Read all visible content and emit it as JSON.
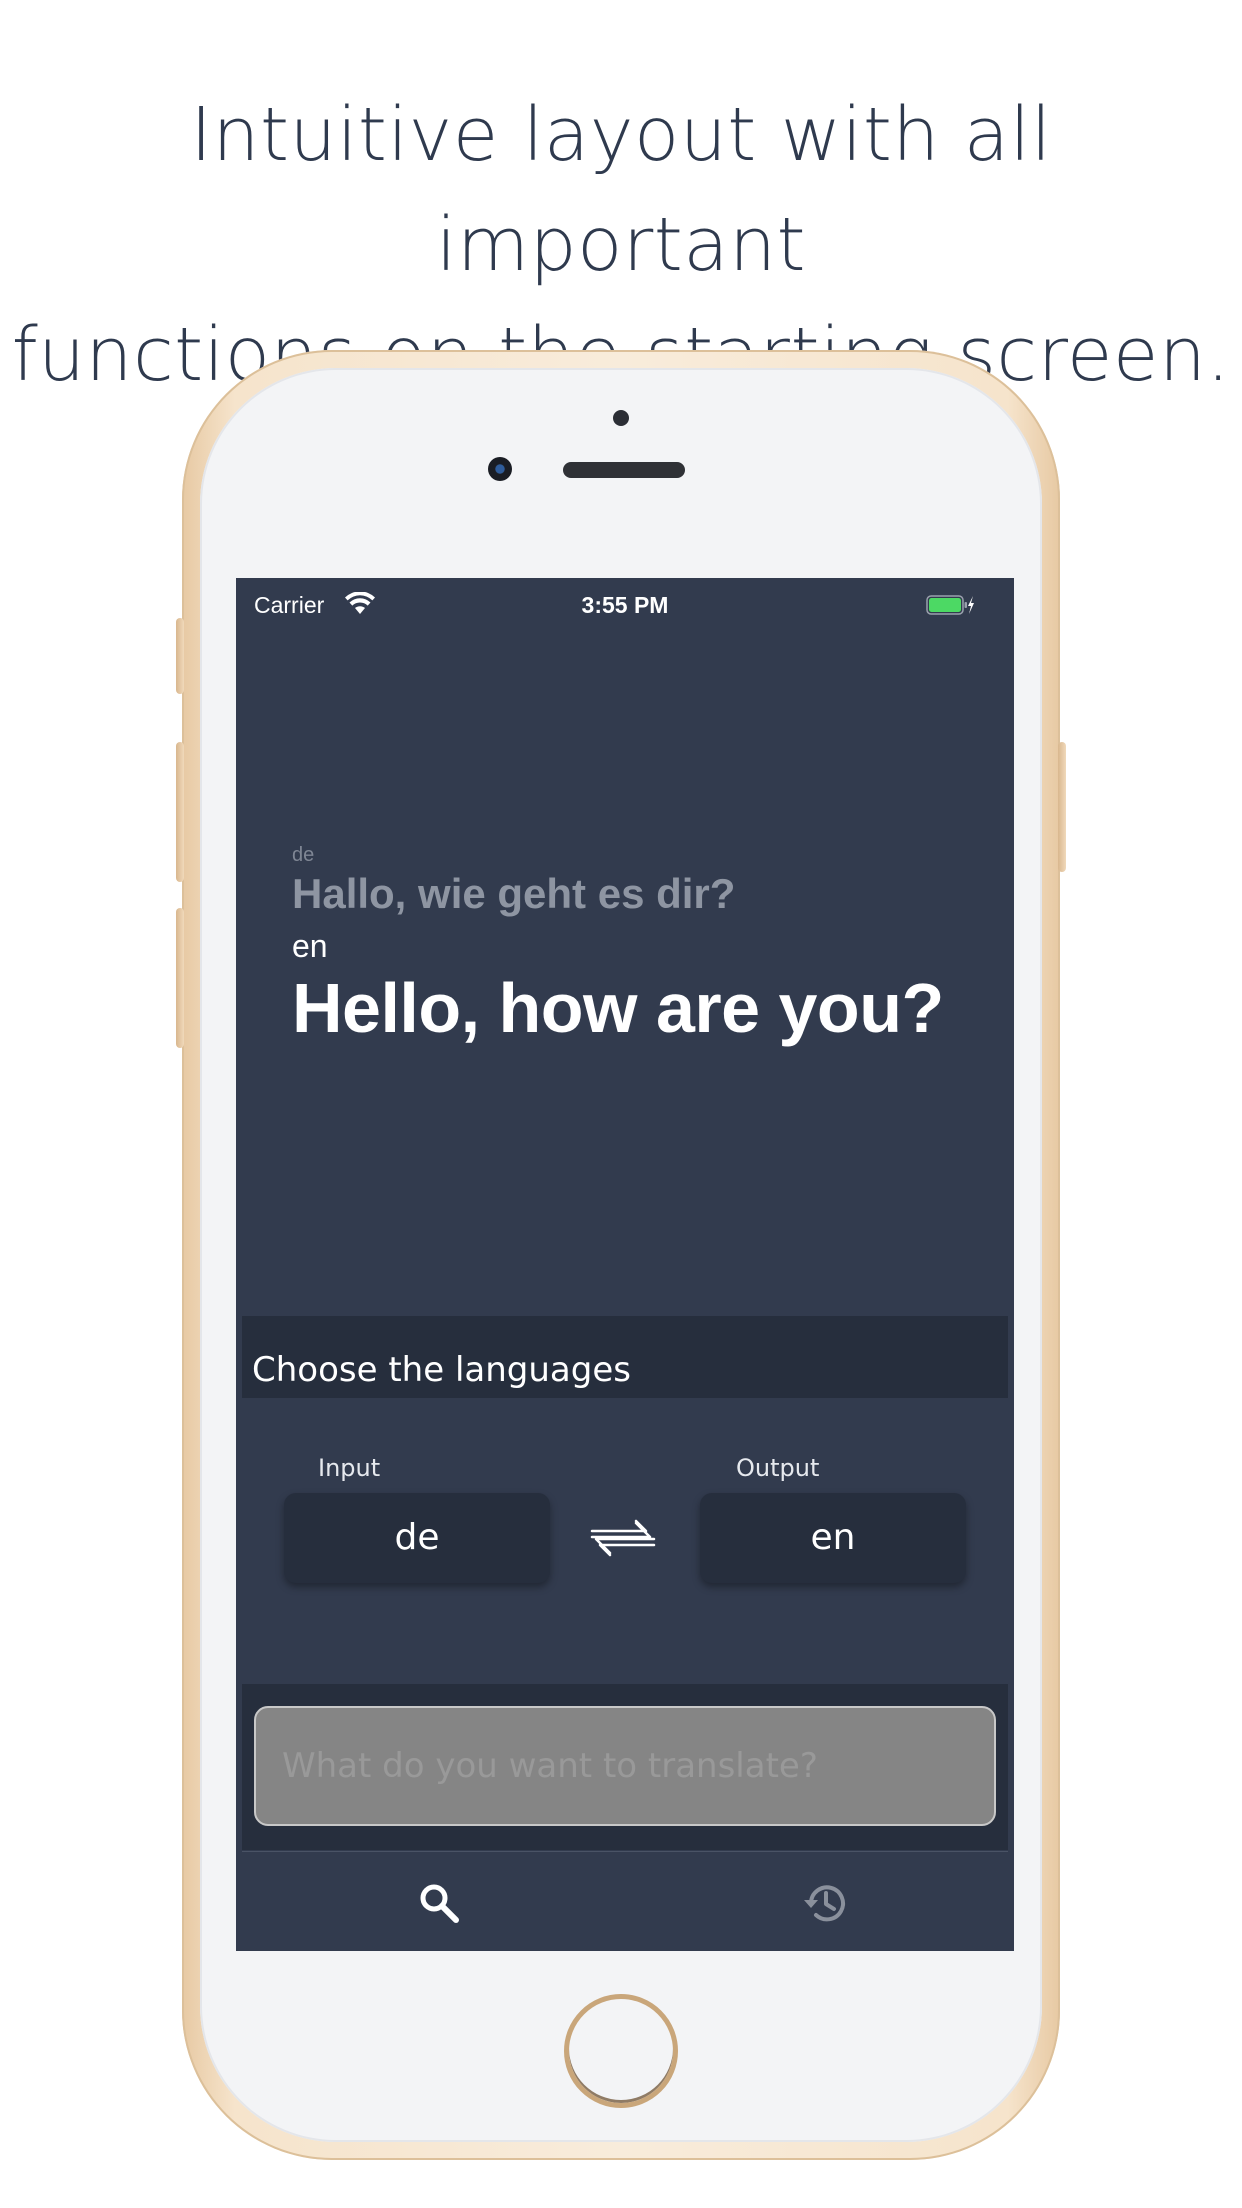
{
  "headline": {
    "line1": "Intuitive layout with all important",
    "line2": "functions on the starting screen."
  },
  "statusbar": {
    "carrier": "Carrier",
    "time": "3:55 PM",
    "icons": [
      "wifi-icon",
      "battery-icon",
      "charging-bolt-icon"
    ],
    "battery_color": "#4cd964"
  },
  "translation": {
    "source_lang": "de",
    "source_text": "Hallo, wie geht es dir?",
    "target_lang": "en",
    "target_text": "Hello, how are you?"
  },
  "languages": {
    "section_title": "Choose the languages",
    "input_label": "Input",
    "input_value": "de",
    "output_label": "Output",
    "output_value": "en",
    "swap_icon": "swap-arrows-icon"
  },
  "search": {
    "placeholder": "What do you want to translate?"
  },
  "tabbar": {
    "tabs": [
      {
        "icon": "search-icon",
        "active": true
      },
      {
        "icon": "history-icon",
        "active": false
      }
    ]
  },
  "colors": {
    "screen_bg": "#323b4e",
    "panel_bg": "#262e3d",
    "headline_text": "#2f3a4e"
  }
}
